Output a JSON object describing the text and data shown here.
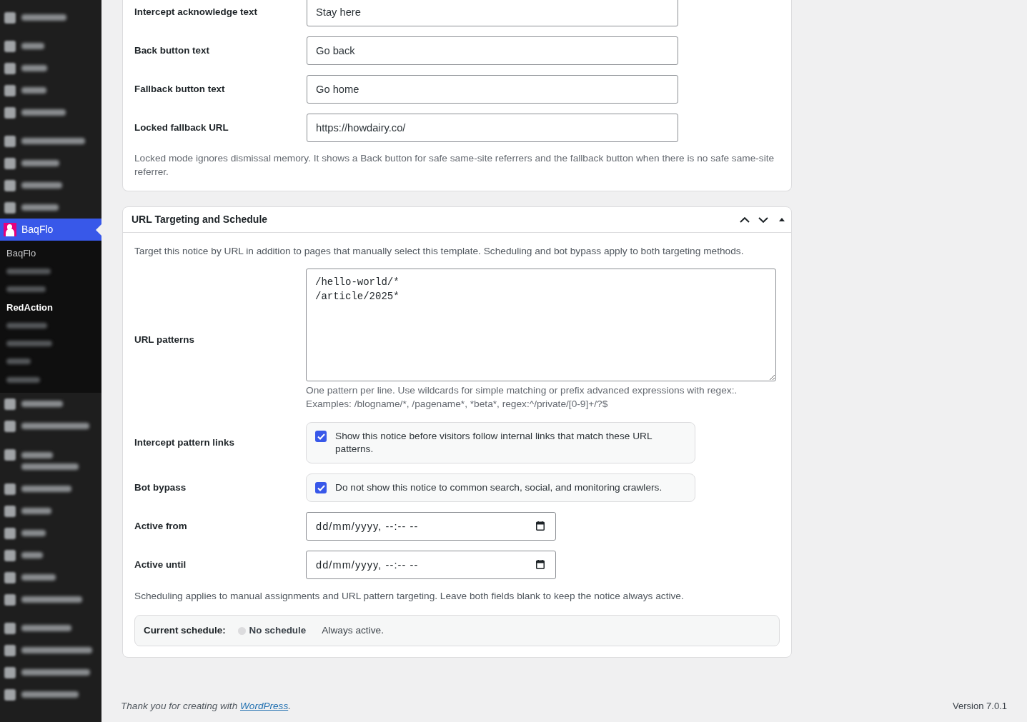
{
  "sidebar": {
    "menu_groups": [
      {
        "items": [
          {
            "kind": "blurred",
            "selected": false
          }
        ]
      },
      {
        "items": [
          {
            "kind": "blurred",
            "selected": false
          },
          {
            "kind": "blurred",
            "selected": false
          },
          {
            "kind": "blurred",
            "selected": false
          },
          {
            "kind": "blurred",
            "selected": false
          }
        ]
      },
      {
        "items": [
          {
            "kind": "blurred",
            "selected": false
          },
          {
            "kind": "blurred",
            "selected": false
          },
          {
            "kind": "blurred",
            "selected": false
          },
          {
            "kind": "blurred",
            "selected": false
          },
          {
            "kind": "label",
            "label": "BaqFlo",
            "selected": true,
            "submenu": [
              {
                "kind": "label",
                "label": "BaqFlo",
                "selected": false
              },
              {
                "kind": "blurred",
                "selected": false
              },
              {
                "kind": "blurred",
                "selected": false
              },
              {
                "kind": "label",
                "label": "RedAction",
                "selected": true
              },
              {
                "kind": "blurred",
                "selected": false
              },
              {
                "kind": "blurred",
                "selected": false
              },
              {
                "kind": "blurred",
                "selected": false
              },
              {
                "kind": "blurred",
                "selected": false
              }
            ]
          },
          {
            "kind": "blurred",
            "selected": false
          },
          {
            "kind": "blurred",
            "selected": false
          }
        ]
      },
      {
        "items": [
          {
            "kind": "wrapped",
            "selected": false
          },
          {
            "kind": "blurred",
            "selected": false
          },
          {
            "kind": "blurred",
            "selected": false
          },
          {
            "kind": "blurred",
            "selected": false
          },
          {
            "kind": "blurred",
            "selected": false
          },
          {
            "kind": "blurred",
            "selected": false
          },
          {
            "kind": "blurred",
            "selected": false
          }
        ]
      },
      {
        "items": [
          {
            "kind": "blurred",
            "selected": false
          },
          {
            "kind": "blurred",
            "selected": false
          },
          {
            "kind": "blurred",
            "selected": false
          },
          {
            "kind": "blurred",
            "selected": false
          }
        ]
      }
    ]
  },
  "settings_panel": {
    "rows": [
      {
        "label": "Intercept acknowledge text",
        "value": "Stay here"
      },
      {
        "label": "Back button text",
        "value": "Go back"
      },
      {
        "label": "Fallback button text",
        "value": "Go home"
      },
      {
        "label": "Locked fallback URL",
        "value": "https://howdairy.co/"
      }
    ],
    "note": "Locked mode ignores dismissal memory. It shows a Back button for safe same-site referrers and the fallback button when there is no safe same-site referrer."
  },
  "url_targeting_panel": {
    "title": "URL Targeting and Schedule",
    "description": "Target this notice by URL in addition to pages that manually select this template. Scheduling and bot bypass apply to both targeting methods.",
    "rows": [
      {
        "kind": "textarea",
        "label": "URL patterns",
        "value": "/hello-world/*\n/article/2025*",
        "help": "One pattern per line. Use wildcards for simple matching or prefix advanced expressions with regex:.\nExamples: /blogname/*, /pagename*, *beta*, regex:^/private/[0-9]+/?$"
      },
      {
        "kind": "checkbox",
        "label": "Intercept pattern links",
        "text": "Show this notice before visitors follow internal links that match these URL patterns.",
        "checked": true
      },
      {
        "kind": "checkbox",
        "label": "Bot bypass",
        "text": "Do not show this notice to common search, social, and monitoring crawlers.",
        "checked": true
      },
      {
        "kind": "datetime",
        "label": "Active from",
        "placeholder": "dd/mm/yyyy, --:-- --"
      },
      {
        "kind": "datetime",
        "label": "Active until",
        "placeholder": "dd/mm/yyyy, --:-- --"
      }
    ],
    "note": "Scheduling applies to manual assignments and URL pattern targeting. Leave both fields blank to keep the notice always active.",
    "current_schedule": {
      "label": "Current schedule:",
      "status": "No schedule",
      "color": "#dcdcde",
      "detail": "Always active."
    }
  },
  "footer": {
    "credit_before": "Thank you for creating with ",
    "credit_link": "WordPress",
    "credit_after": ".",
    "version": "Version 7.0.1"
  }
}
